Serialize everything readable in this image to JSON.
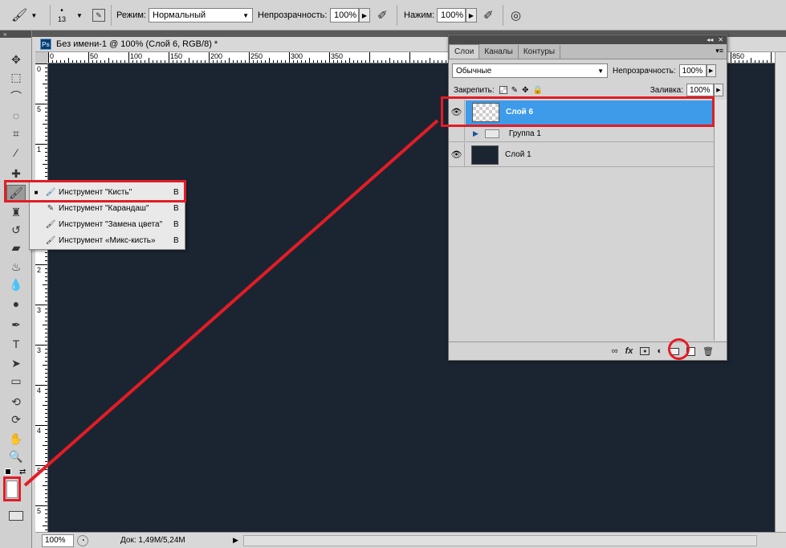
{
  "options_bar": {
    "brush_size": "13",
    "mode_label": "Режим:",
    "mode_value": "Нормальный",
    "opacity_label": "Непрозрачность:",
    "opacity_value": "100%",
    "flow_label": "Нажим:",
    "flow_value": "100%"
  },
  "document": {
    "title": "Без имени-1 @ 100% (Слой 6, RGB/8) *",
    "ps_icon": "Ps",
    "canvas_color": "#1b2532",
    "zoom": "100%",
    "doc_info": "Док: 1,49M/5,24M",
    "ruler_h": [
      "0",
      "50",
      "100",
      "150",
      "200",
      "250",
      "300",
      "350",
      "850"
    ],
    "ruler_v": [
      "0",
      "5",
      "1",
      "1",
      "2",
      "2",
      "3",
      "3",
      "4",
      "4",
      "5",
      "5",
      "6"
    ]
  },
  "toolbox": {
    "tools": [
      "move-icon",
      "marquee-icon",
      "lasso-icon",
      "quick-select-icon",
      "crop-icon",
      "eyedropper-icon",
      "healing-icon",
      "brush-icon",
      "stamp-icon",
      "history-brush-icon",
      "eraser-icon",
      "paint-bucket-icon",
      "blur-icon",
      "dodge-icon",
      "pen-icon",
      "type-icon",
      "path-select-icon",
      "shape-icon",
      "3d-rotate-icon",
      "3d-orbit-icon",
      "hand-icon",
      "zoom-icon"
    ],
    "selected": "brush-icon"
  },
  "flyout": {
    "items": [
      {
        "label": "Инструмент \"Кисть\"",
        "key": "B",
        "selected": true
      },
      {
        "label": "Инструмент \"Карандаш\"",
        "key": "B",
        "selected": false
      },
      {
        "label": "Инструмент \"Замена цвета\"",
        "key": "B",
        "selected": false
      },
      {
        "label": "Инструмент «Микс-кисть»",
        "key": "B",
        "selected": false
      }
    ]
  },
  "layers_panel": {
    "tabs": [
      "Слои",
      "Каналы",
      "Контуры"
    ],
    "active_tab": "Слои",
    "blend_mode": "Обычные",
    "opacity_label": "Непрозрачность:",
    "opacity_value": "100%",
    "lock_label": "Закрепить:",
    "fill_label": "Заливка:",
    "fill_value": "100%",
    "layers": [
      {
        "name": "Слой 6",
        "visible": true,
        "selected": true,
        "type": "transparent"
      },
      {
        "name": "Группа 1",
        "visible": false,
        "selected": false,
        "type": "group"
      },
      {
        "name": "Слой 1",
        "visible": true,
        "selected": false,
        "type": "fill"
      }
    ],
    "bottom_icons": [
      "link-icon",
      "fx-icon",
      "mask-icon",
      "adjustment-icon",
      "group-icon",
      "new-layer-icon",
      "trash-icon"
    ],
    "bottom_fx": "fx"
  },
  "colors": {
    "selection_blue": "#3d9be9",
    "annotation_red": "#e31c25",
    "canvas": "#1b2532"
  }
}
